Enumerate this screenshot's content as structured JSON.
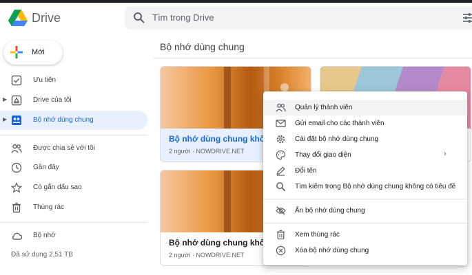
{
  "header": {
    "brand": "Drive",
    "search_placeholder": "Tìm trong Drive"
  },
  "sidebar": {
    "new_label": "Mới",
    "items": [
      {
        "label": "Ưu tiên",
        "icon": "priority-check-icon"
      },
      {
        "label": "Drive của tôi",
        "icon": "my-drive-icon"
      },
      {
        "label": "Bộ nhớ dùng chung",
        "icon": "shared-drives-icon",
        "active": true
      },
      {
        "label": "Được chia sẻ với tôi",
        "icon": "people-icon"
      },
      {
        "label": "Gần đây",
        "icon": "clock-icon"
      },
      {
        "label": "Có gắn dấu sao",
        "icon": "star-icon"
      },
      {
        "label": "Thùng rác",
        "icon": "trash-icon"
      },
      {
        "label": "Bộ nhớ",
        "icon": "cloud-icon"
      }
    ],
    "storage_used": "Đã sử dụng 2,51 TB"
  },
  "main": {
    "title": "Bộ nhớ dùng chung",
    "cards": [
      {
        "title": "Bộ nhớ dùng chung không",
        "meta": "2 người · NOWDRIVE.NET",
        "selected": true
      },
      {
        "title": "",
        "meta": ""
      },
      {
        "title": "Bộ nhớ dùng chung không",
        "meta": "2 người · NOWDRIVE.NET"
      }
    ]
  },
  "context_menu": {
    "items": [
      {
        "label": "Quản lý thành viên",
        "icon": "manage-members-icon"
      },
      {
        "label": "Gửi email cho các thành viên",
        "icon": "email-icon"
      },
      {
        "label": "Cài đặt bộ nhớ dùng chung",
        "icon": "settings-gear-icon"
      },
      {
        "label": "Thay đổi giao diện",
        "icon": "palette-icon",
        "submenu": true
      },
      {
        "label": "Đổi tên",
        "icon": "rename-pencil-icon"
      },
      {
        "label": "Tìm kiếm trong Bộ nhớ dùng chung không có tiêu đề",
        "icon": "search-icon"
      },
      {
        "label": "Ẩn bộ nhớ dùng chung",
        "icon": "hide-eye-icon"
      },
      {
        "label": "Xem thùng rác",
        "icon": "trash-icon"
      },
      {
        "label": "Xóa bộ nhớ dùng chung",
        "icon": "delete-circle-x-icon"
      }
    ]
  },
  "colors": {
    "accent": "#1967d2",
    "active_bg": "#e8f0fe"
  }
}
